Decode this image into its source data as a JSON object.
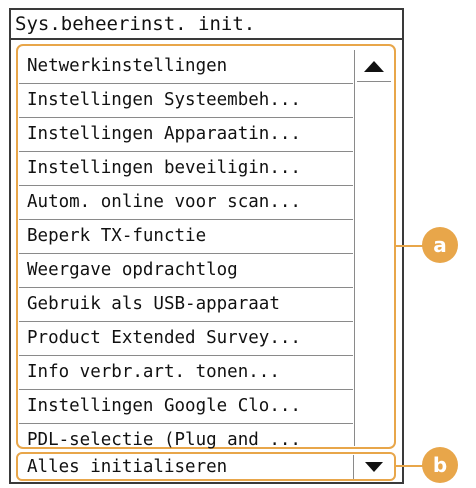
{
  "screen": {
    "title": "Sys.beheerinst. init."
  },
  "menu": {
    "items": [
      {
        "label": "Netwerkinstellingen"
      },
      {
        "label": "Instellingen Systeembeh..."
      },
      {
        "label": "Instellingen Apparaatin..."
      },
      {
        "label": "Instellingen beveiligin..."
      },
      {
        "label": "Autom. online voor scan..."
      },
      {
        "label": "Beperk TX-functie"
      },
      {
        "label": "Weergave opdrachtlog"
      },
      {
        "label": "Gebruik als USB-apparaat"
      },
      {
        "label": "Product Extended Survey..."
      },
      {
        "label": "Info verbr.art. tonen..."
      },
      {
        "label": "Instellingen Google Clo..."
      },
      {
        "label": "PDL-selectie (Plug and ..."
      }
    ],
    "scroll_up_icon": "triangle-up-icon"
  },
  "selector": {
    "value": "Alles initialiseren",
    "dropdown_icon": "triangle-down-icon"
  },
  "callouts": {
    "a": "a",
    "b": "b"
  },
  "colors": {
    "accent": "#e8a64a",
    "border": "#3a3a3a",
    "separator": "#8a8a8a"
  }
}
